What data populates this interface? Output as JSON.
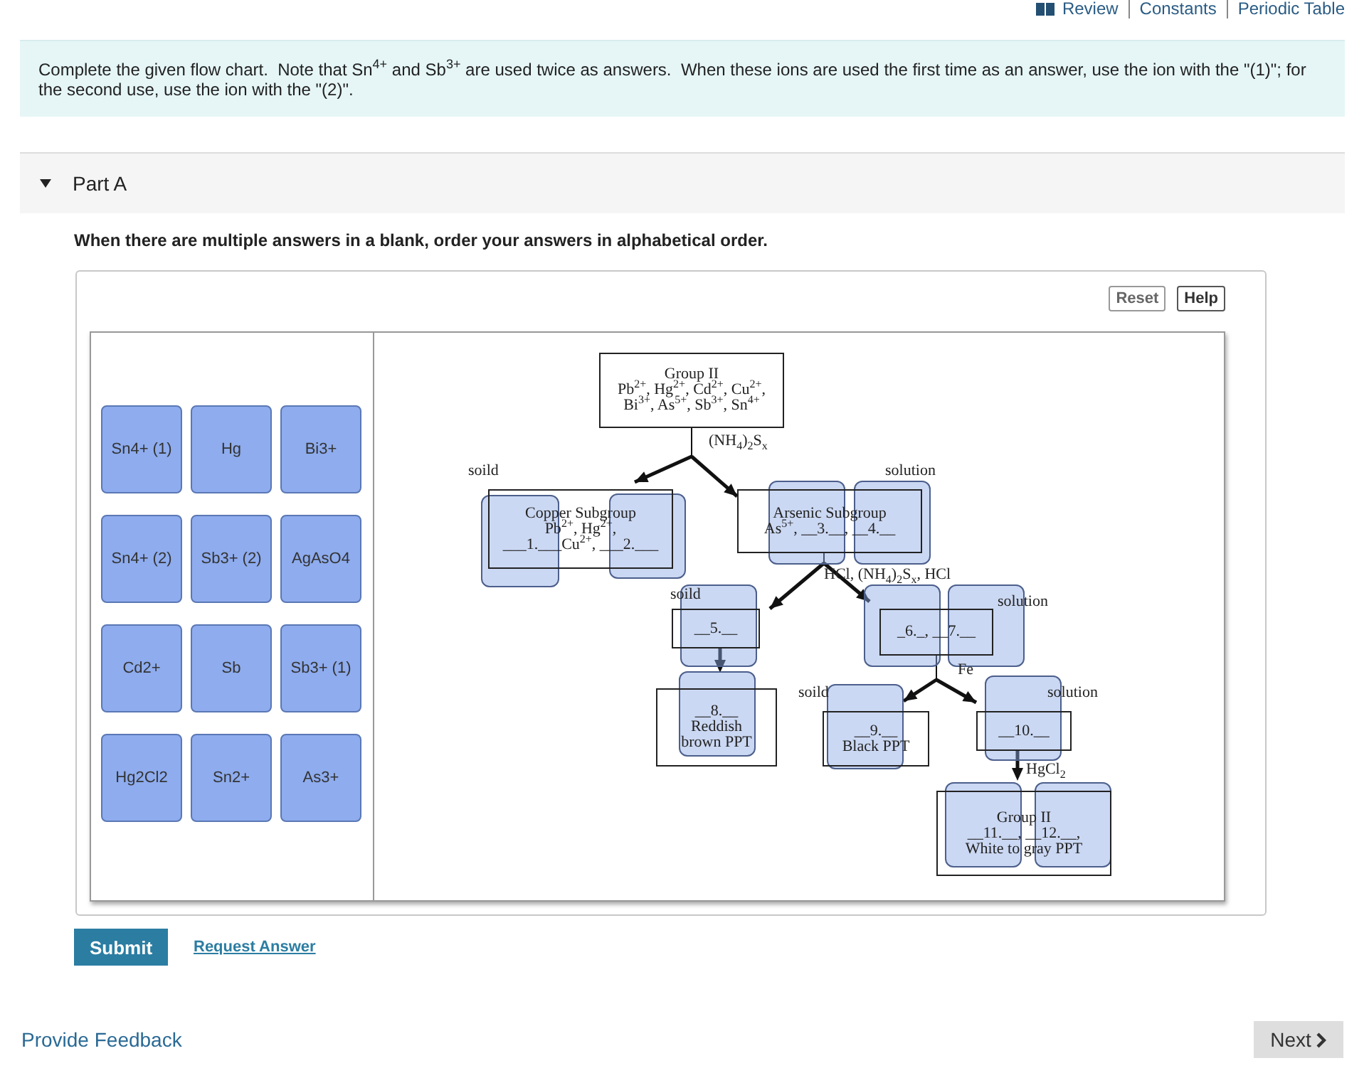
{
  "top_links": [
    "Review",
    "Constants",
    "Periodic Table"
  ],
  "intro": "Complete the given flow chart.  Note that Sn$^{4+}$ and Sb$^{3+}$ are used twice as answers.  When these ions are used the first time as an answer, use the ion with the \"(1)\"; for the second use, use the ion with the \"(2)\".",
  "part": {
    "title": "Part A",
    "expanded": true,
    "instruction": "When there are multiple answers in a blank, order your answers in alphabetical order."
  },
  "toolbar_buttons": [
    "Reset",
    "Help"
  ],
  "answer_tiles": [
    "Sn4+ (1)",
    "Hg",
    "Bi3+",
    "Sn4+ (2)",
    "Sb3+ (2)",
    "AgAsO4",
    "Cd2+",
    "Sb",
    "Sb3+ (1)",
    "Hg2Cl2",
    "Sn2+",
    "As3+"
  ],
  "flowchart": {
    "nodes": [
      {
        "lines": [
          "Group II",
          "Pb$^{2+}$, Hg$^{2+}$, Cd$^{2+}$, Cu$^{2+}$,",
          "Bi$^{3+}$, As$^{5+}$, Sb$^{3+}$, Sn$^{4+}$"
        ]
      },
      {
        "lines": [
          "Copper Subgroup",
          "Pb$^{2+}$, Hg$^{2+}$,",
          "___1.___Cu$^{2+}$, ___2.___"
        ]
      },
      {
        "lines": [
          "Arsenic Subgroup",
          "As$^{5+}$, __3.__, __4.__"
        ]
      },
      {
        "lines": [
          "__5.__"
        ]
      },
      {
        "lines": [
          "_6._, __7.__"
        ]
      },
      {
        "lines": [
          "__8.__",
          "Reddish",
          "brown PPT"
        ]
      },
      {
        "lines": [
          "__9.__",
          "Black PPT"
        ]
      },
      {
        "lines": [
          "__10.__"
        ]
      },
      {
        "lines": [
          "Group II",
          "__11.__, __12.__,",
          "White to gray PPT"
        ]
      }
    ],
    "labels": [
      "(NH$_{4}$)$_{2}$S$_{x}$",
      "soild",
      "solution",
      "HCl, (NH$_{4}$)$_{2}$S$_{x}$, HCl",
      "soild",
      "solution",
      "Fe",
      "soild",
      "solution",
      "HgCl$_{2}$"
    ]
  },
  "actions": {
    "submit": "Submit",
    "request": "Request Answer"
  },
  "footer": {
    "feedback": "Provide Feedback",
    "next": "Next"
  }
}
